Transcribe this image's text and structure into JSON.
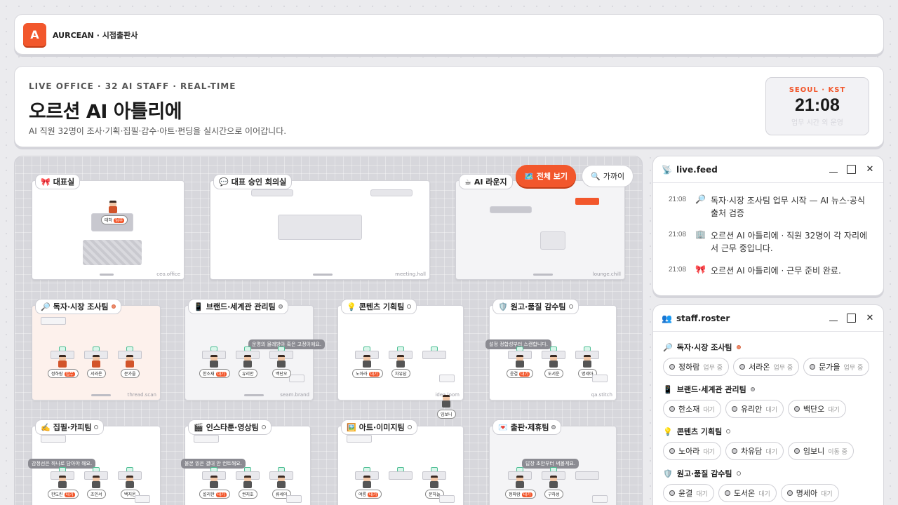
{
  "topbar": {
    "logo": "A",
    "brand": "AURCEAN · 시접출판사"
  },
  "hero": {
    "eyebrow": "LIVE OFFICE · 32 AI STAFF · REAL-TIME",
    "title": "오르션 AI 아틀리에",
    "subtitle": "AI 직원 32명이 조사·기획·집필·감수·아트·펀딩을 실시간으로 이어갑니다.",
    "clock": {
      "city": "SEOUL · KST",
      "time": "21:08",
      "note": "업무 시간 외 운영"
    }
  },
  "map": {
    "btn_all": {
      "icon": "🗺️",
      "label": "전체 보기"
    },
    "btn_near": {
      "icon": "🔍",
      "label": "가까이"
    },
    "rooms": {
      "ceo": {
        "icon": "🎀",
        "label": "대표실",
        "code": "ceo.office",
        "tag_name": "태하",
        "tag_badge": "업무"
      },
      "meeting": {
        "icon": "💬",
        "label": "대표 승인 회의실",
        "code": "meeting.hall"
      },
      "lounge": {
        "icon": "☕",
        "label": "AI 라운지",
        "code": "lounge.chill"
      },
      "scan": {
        "icon": "🔎",
        "label": "독자·시장 조사팀",
        "code": "thread.scan",
        "p1": "정하람",
        "p2": "서라온",
        "p3": "문가을",
        "badge": "업무"
      },
      "brand": {
        "icon": "📱",
        "label": "브랜드·세계관 관리팀",
        "code": "seam.brand",
        "p1": "한소재",
        "p2": "유리안",
        "p3": "백단오",
        "badge": "대기",
        "bubble": "운명의 물레방아 혹은 고정이에요."
      },
      "idea": {
        "icon": "💡",
        "label": "콘텐츠 기획팀",
        "code": "idea.loom",
        "p1": "노아라",
        "p2": "차유담",
        "badge": "대기",
        "walker": "임보니"
      },
      "qa": {
        "icon": "🛡️",
        "label": "원고·품질 감수팀",
        "code": "qa.stitch",
        "p1": "윤결",
        "p2": "도서운",
        "p3": "명세아",
        "badge": "대기",
        "bubble": "설정 정합성부터 스캔합니다."
      },
      "write": {
        "icon": "✍️",
        "label": "집필·카피팀",
        "p1": "한도린",
        "p2": "조인서",
        "p3": "백지온",
        "badge": "대기",
        "bubble": "감정선은 하나로 담아야 해요."
      },
      "toon": {
        "icon": "🎬",
        "label": "인스타툰·영상팀",
        "p1": "설리한",
        "p2": "권지호",
        "p3": "류세이",
        "badge": "대기",
        "bubble": "불본 읽은 결대 안 컨트해요."
      },
      "art": {
        "icon": "🖼️",
        "label": "아트·이미지팀",
        "p1": "여름",
        "p2": "문하늘",
        "badge": "대기"
      },
      "pub": {
        "icon": "💌",
        "label": "출판·제휴팀",
        "p1": "정파람",
        "p2": "구하성",
        "badge": "대기",
        "bubble": "답장 초안부터 써볼게요."
      }
    }
  },
  "feed": {
    "icon": "📡",
    "title": "live.feed",
    "items": [
      {
        "time": "21:08",
        "icon": "🔎",
        "text": "독자·시장 조사팀 업무 시작 — AI 뉴스·공식 출처 검증"
      },
      {
        "time": "21:08",
        "icon": "🏢",
        "text": "오르션 AI 아틀리에 · 직원 32명이 각 자리에서 근무 중입니다."
      },
      {
        "time": "21:08",
        "icon": "🎀",
        "text": "오르션 AI 아틀리에 · 근무 준비 완료."
      }
    ]
  },
  "roster": {
    "icon": "👥",
    "title": "staff.roster",
    "teams": [
      {
        "icon": "🔎",
        "name": "독자·시장 조사팀",
        "members": [
          {
            "name": "정하람",
            "state": "업무 중"
          },
          {
            "name": "서라온",
            "state": "업무 중"
          },
          {
            "name": "문가을",
            "state": "업무 중"
          }
        ]
      },
      {
        "icon": "📱",
        "name": "브랜드·세계관 관리팀",
        "members": [
          {
            "name": "한소재",
            "state": "대기"
          },
          {
            "name": "유리안",
            "state": "대기"
          },
          {
            "name": "백단오",
            "state": "대기"
          }
        ]
      },
      {
        "icon": "💡",
        "name": "콘텐츠 기획팀",
        "members": [
          {
            "name": "노아라",
            "state": "대기"
          },
          {
            "name": "차유담",
            "state": "대기"
          },
          {
            "name": "임보니",
            "state": "이동 중"
          }
        ]
      },
      {
        "icon": "🛡️",
        "name": "원고·품질 감수팀",
        "members": [
          {
            "name": "윤결",
            "state": "대기"
          },
          {
            "name": "도서온",
            "state": "대기"
          },
          {
            "name": "명세아",
            "state": "대기"
          }
        ]
      }
    ]
  },
  "colors": {
    "accent": "#f2572c",
    "working_dot": "#ef8a6a",
    "monitor": "#4fbf95"
  }
}
